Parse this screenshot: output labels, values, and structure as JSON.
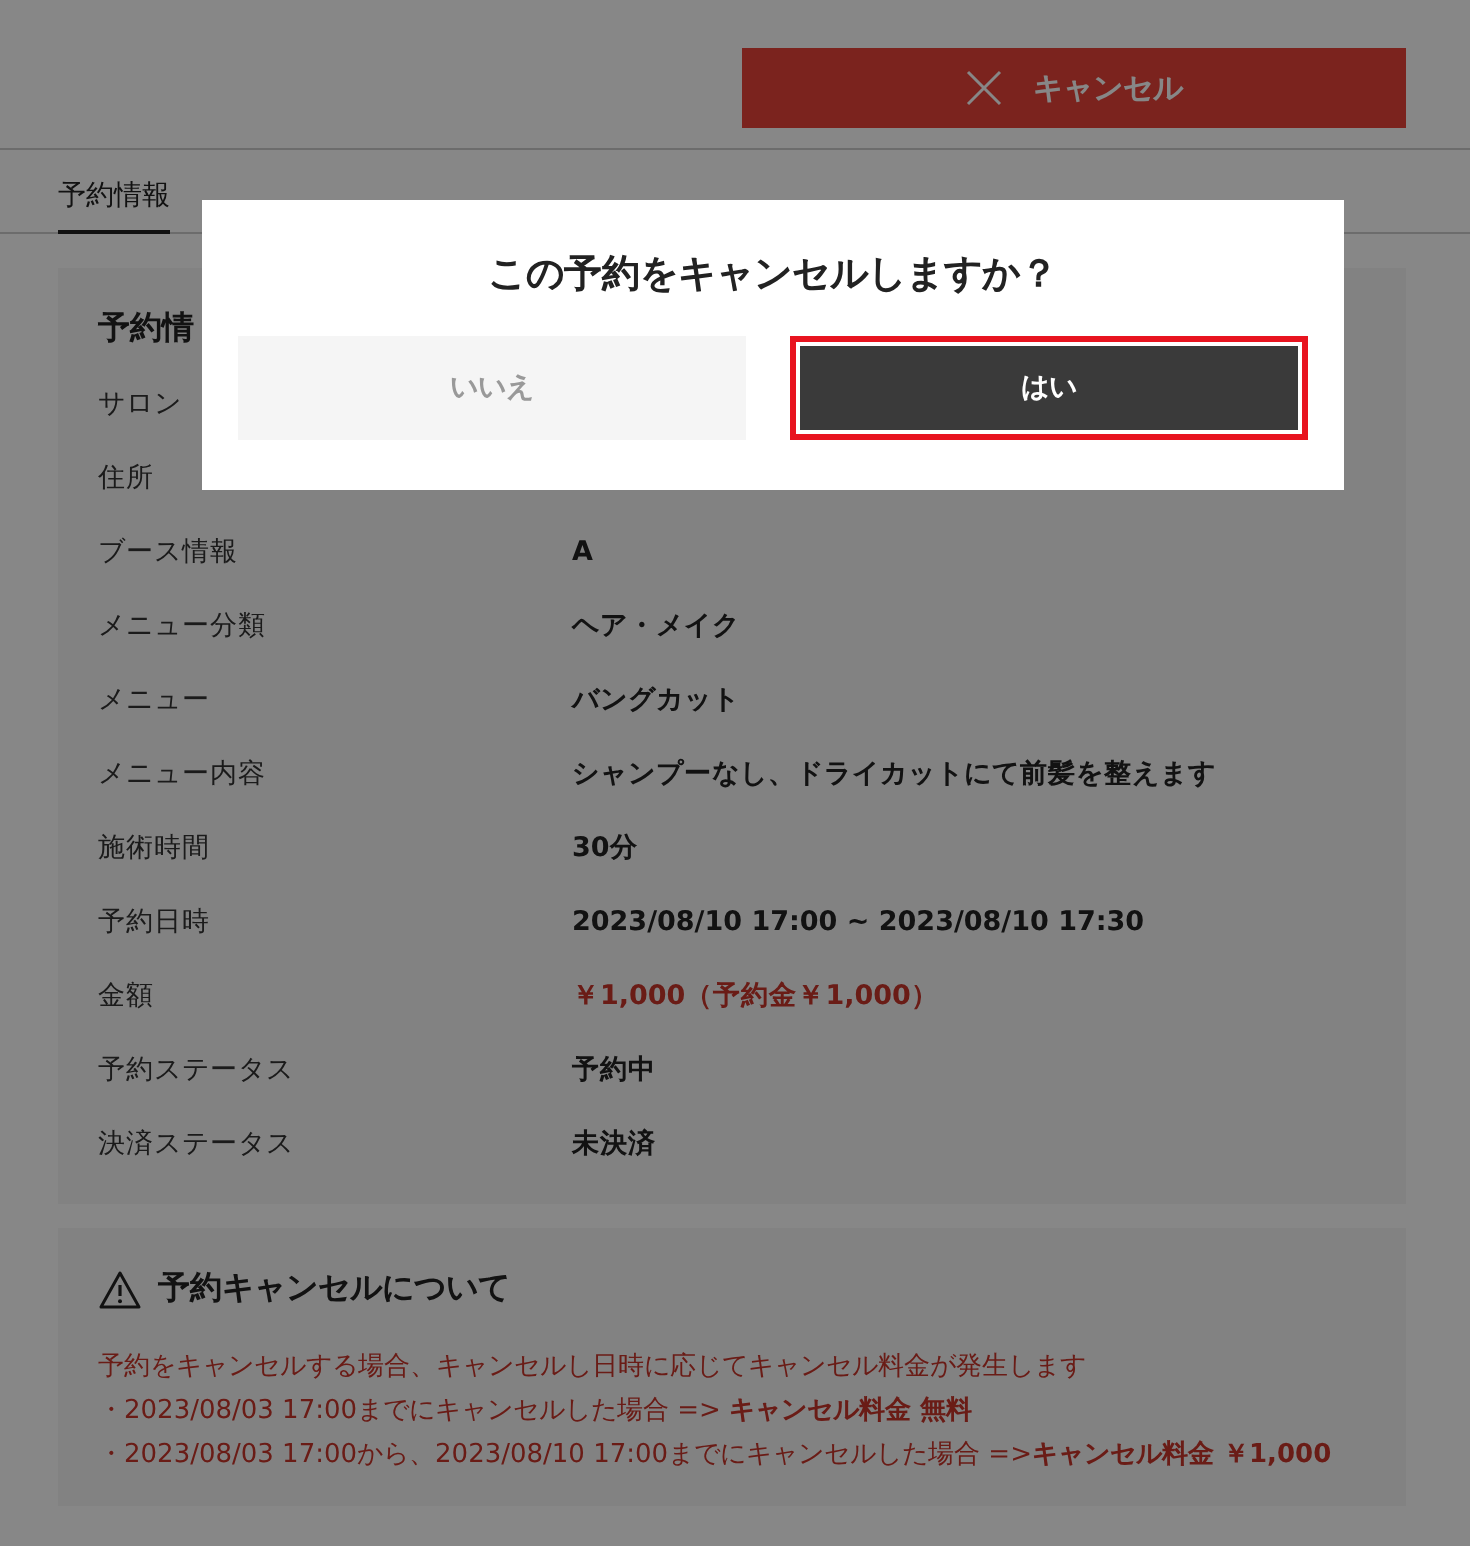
{
  "header": {
    "cancel_button": {
      "label": "キャンセル"
    }
  },
  "tabs": [
    {
      "label": "予約情報",
      "selected": true
    }
  ],
  "details": {
    "title": "予約情",
    "rows": [
      {
        "label": "サロン"
      },
      {
        "label": "住所"
      },
      {
        "label": "ブース情報",
        "value": "A",
        "kind": "plain"
      },
      {
        "label": "メニュー分類",
        "value": "ヘア・メイク",
        "kind": "plain"
      },
      {
        "label": "メニュー",
        "value": "バングカット",
        "kind": "plain"
      },
      {
        "label": "メニュー内容",
        "value": "シャンプーなし、ドライカットにて前髪を整えます",
        "kind": "plain"
      },
      {
        "label": "施術時間",
        "value": "30分",
        "kind": "plain"
      },
      {
        "label": "予約日時",
        "value": "2023/08/10 17:00 ~ 2023/08/10 17:30",
        "kind": "plain"
      },
      {
        "label": "金額",
        "value": "￥1,000（予約金￥1,000）",
        "kind": "price"
      },
      {
        "label": "予約ステータス",
        "value": "予約中",
        "kind": "plain"
      },
      {
        "label": "決済ステータス",
        "value": "未決済",
        "kind": "plain"
      }
    ]
  },
  "notice": {
    "title": "予約キャンセルについて",
    "lines": [
      "予約をキャンセルする場合、キャンセルし日時に応じてキャンセル料金が発生します",
      "・2023/08/03 17:00までにキャンセルした場合 => **キャンセル料金 無料**",
      "・2023/08/03 17:00から、2023/08/10  17:00までにキャンセルした場合 =>**キャンセル料金 ￥1,000**"
    ]
  },
  "dialog": {
    "title": "この予約をキャンセルしますか？",
    "buttons": [
      {
        "label": "いいえ",
        "kind": "secondary",
        "highlighted": false
      },
      {
        "label": "はい",
        "kind": "primary",
        "highlighted": true
      }
    ]
  }
}
